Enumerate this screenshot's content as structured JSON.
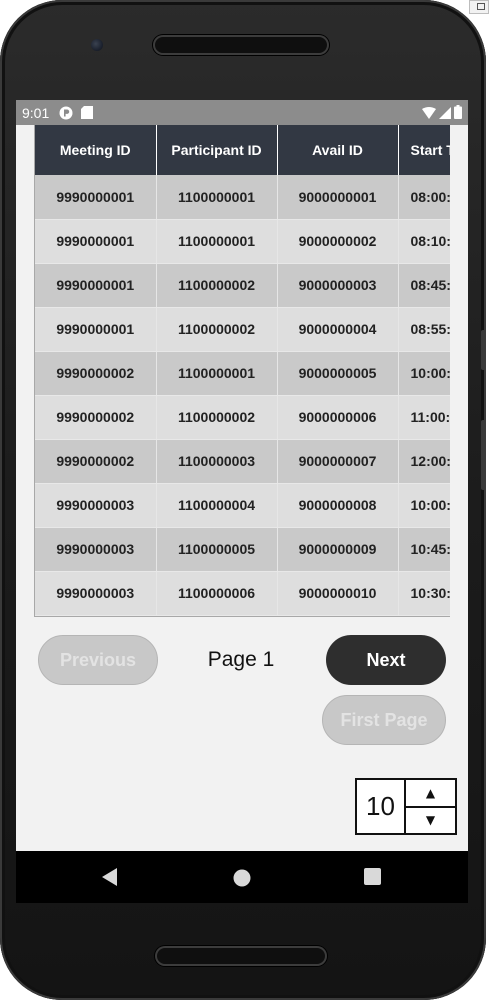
{
  "status_bar": {
    "time": "9:01"
  },
  "table": {
    "columns": [
      "Meeting ID",
      "Participant ID",
      "Avail ID",
      "Start T"
    ],
    "rows": [
      [
        "9990000001",
        "1100000001",
        "9000000001",
        "08:00:"
      ],
      [
        "9990000001",
        "1100000001",
        "9000000002",
        "08:10:"
      ],
      [
        "9990000001",
        "1100000002",
        "9000000003",
        "08:45:"
      ],
      [
        "9990000001",
        "1100000002",
        "9000000004",
        "08:55:"
      ],
      [
        "9990000002",
        "1100000001",
        "9000000005",
        "10:00:"
      ],
      [
        "9990000002",
        "1100000002",
        "9000000006",
        "11:00:"
      ],
      [
        "9990000002",
        "1100000003",
        "9000000007",
        "12:00:"
      ],
      [
        "9990000003",
        "1100000004",
        "9000000008",
        "10:00:"
      ],
      [
        "9990000003",
        "1100000005",
        "9000000009",
        "10:45:"
      ],
      [
        "9990000003",
        "1100000006",
        "9000000010",
        "10:30:"
      ]
    ]
  },
  "pagination": {
    "previous_label": "Previous",
    "page_label": "Page 1",
    "next_label": "Next",
    "first_page_label": "First Page"
  },
  "page_size": {
    "value": "10",
    "up_arrow": "▲",
    "down_arrow": "▼"
  },
  "colors": {
    "header_bg": "#323843",
    "row_odd": "#c9c9c9",
    "row_even": "#dedede",
    "next_button": "#2e2e2e",
    "disabled_button": "#c8c8c8"
  },
  "icons": {
    "status_left": [
      "app-notification-icon",
      "sd-card-icon"
    ],
    "status_right": [
      "wifi-icon",
      "signal-icon",
      "battery-icon"
    ],
    "nav": [
      "back-icon",
      "home-icon",
      "recents-icon"
    ]
  }
}
